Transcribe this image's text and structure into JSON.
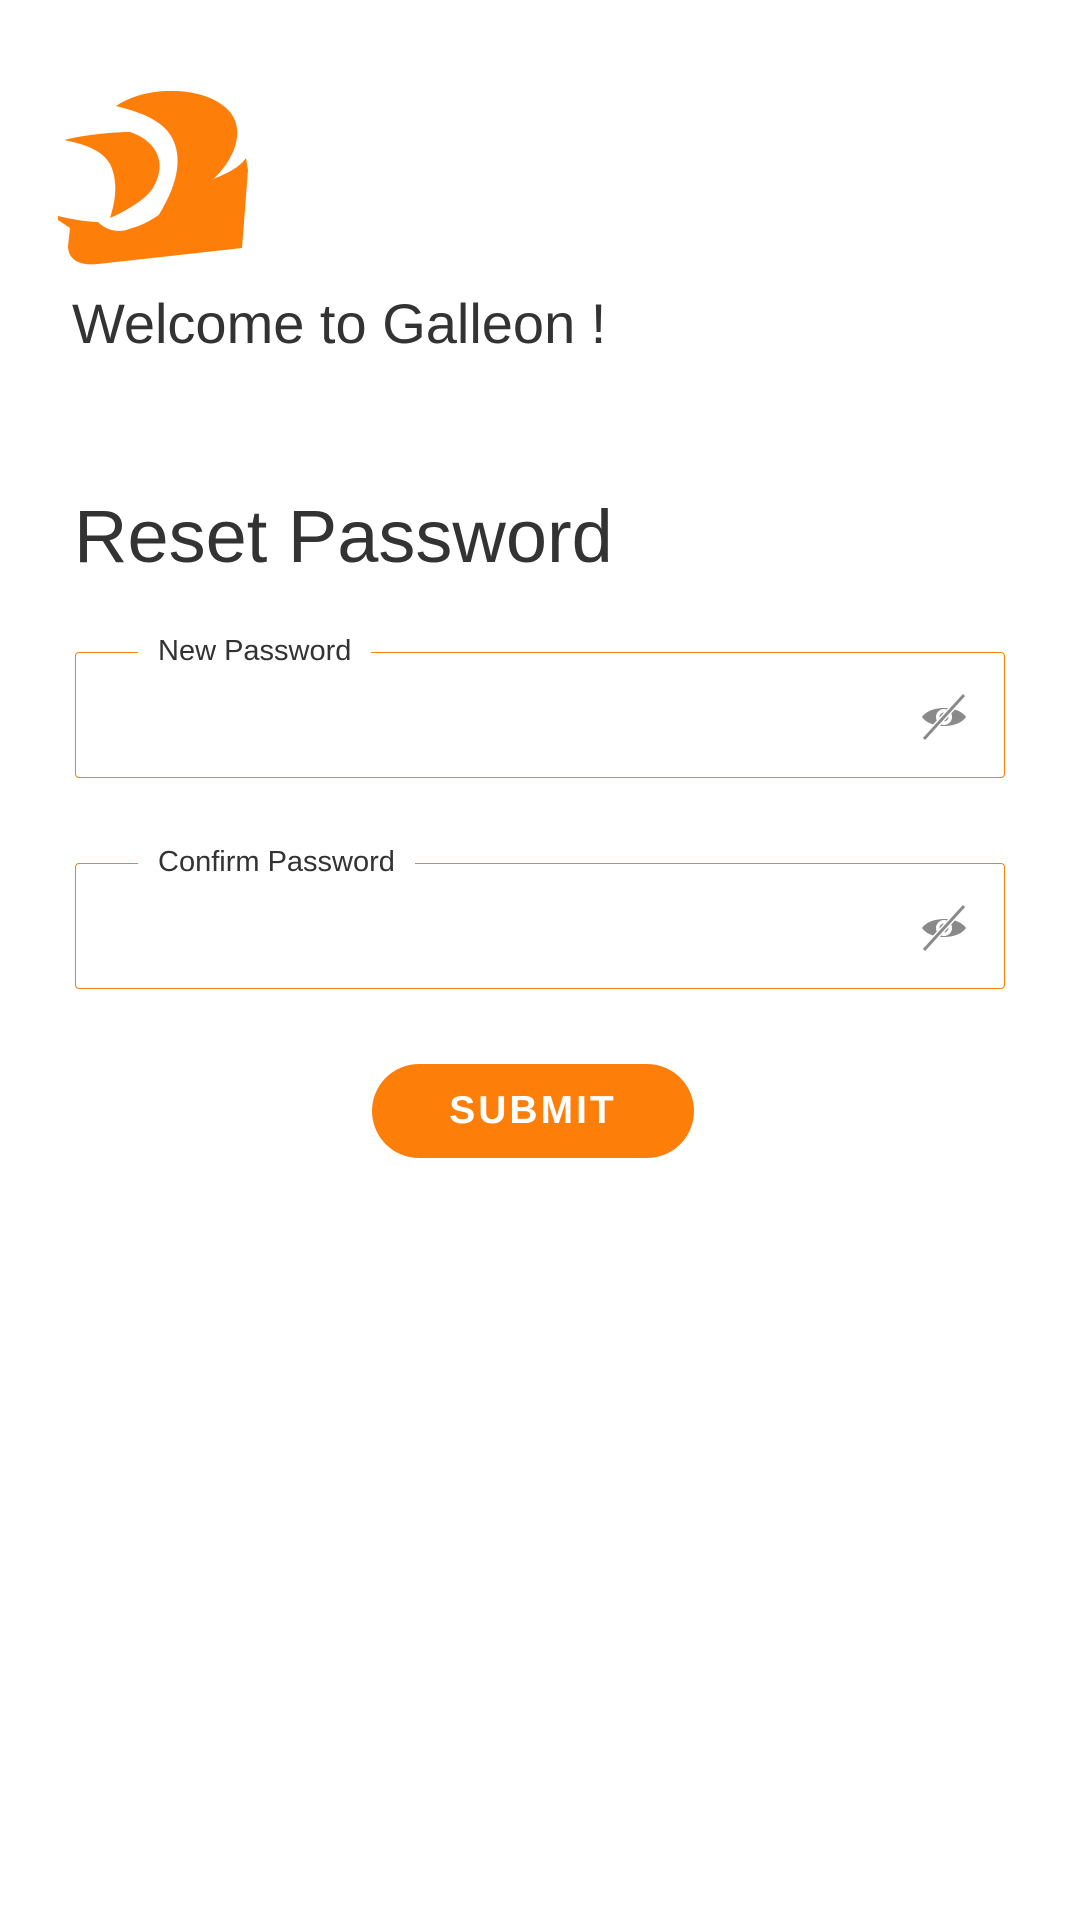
{
  "brand": {
    "logo_icon": "galleon-ship-sail-icon",
    "accent_color": "#fd7e09"
  },
  "header": {
    "welcome_text": "Welcome to Galleon !"
  },
  "form": {
    "title": "Reset Password",
    "new_password": {
      "label": "New Password",
      "value": "",
      "toggle_icon": "eye-slash-icon"
    },
    "confirm_password": {
      "label": "Confirm Password",
      "value": "",
      "toggle_icon": "eye-slash-icon"
    },
    "submit_label": "SUBMIT"
  }
}
